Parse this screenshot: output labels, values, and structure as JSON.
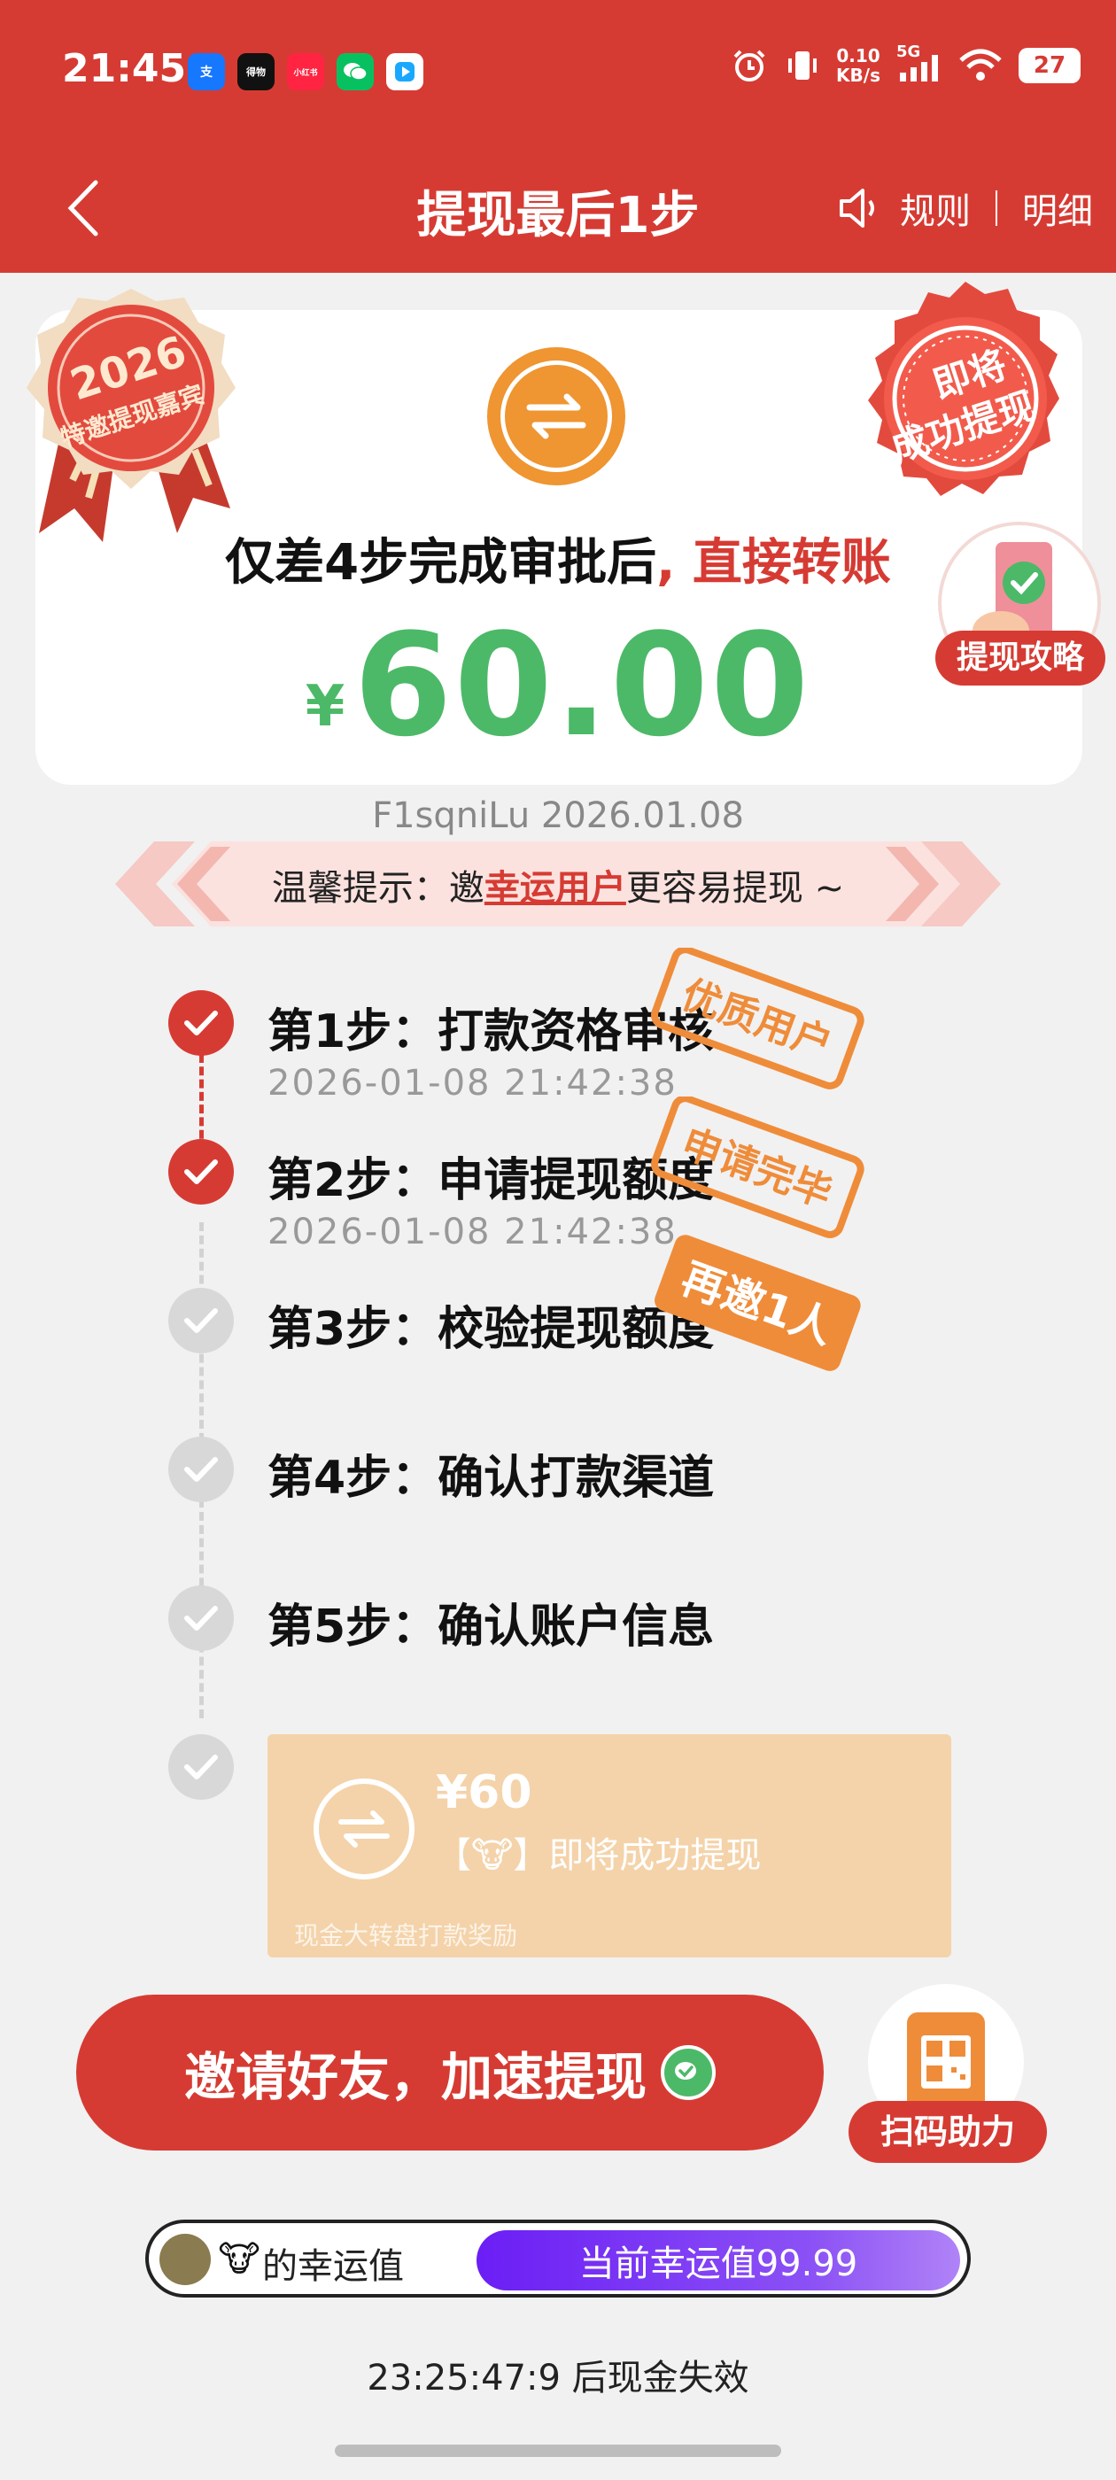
{
  "status_bar": {
    "time": "21:45",
    "apps": [
      {
        "label": "支",
        "color": "#1677ff",
        "icon": "alipay-icon"
      },
      {
        "label": "得物",
        "color": "#111111",
        "icon": "dewu-icon"
      },
      {
        "label": "小红书",
        "color": "#ff2442",
        "icon": "xiaohongshu-icon"
      },
      {
        "label": "",
        "color": "#07c160",
        "icon": "wechat-icon"
      },
      {
        "label": "",
        "color": "#ffffff",
        "icon": "video-app-icon"
      }
    ],
    "net_speed_value": "0.10",
    "net_speed_unit": "KB/s",
    "signal": "5G",
    "battery": "27"
  },
  "nav": {
    "title": "提现最后1步",
    "rules": "规则",
    "details": "明细"
  },
  "card": {
    "seal_left_line1": "2026",
    "seal_left_line2": "特邀提现嘉宾",
    "seal_right_line1": "即将",
    "seal_right_line2": "成功提现",
    "guide_label": "提现攻略",
    "line_black": "仅差4步完成审批后",
    "line_red": ", 直接转账",
    "currency": "¥",
    "amount": "60.00"
  },
  "user_line": "F1sqniLu 2026.01.08",
  "tip": {
    "prefix": "温馨提示：邀",
    "link": "幸运用户",
    "suffix": "更容易提现 ~"
  },
  "steps": [
    {
      "title": "第1步：打款资格审核",
      "time": "2026-01-08 21:42:38",
      "done": true,
      "stamp": "优质用户"
    },
    {
      "title": "第2步：申请提现额度",
      "time": "2026-01-08 21:42:38",
      "done": true,
      "stamp": "申请完毕"
    },
    {
      "title": "第3步：校验提现额度",
      "time": "",
      "done": false,
      "stamp": "再邀1人"
    },
    {
      "title": "第4步：确认打款渠道",
      "time": "",
      "done": false,
      "stamp": ""
    },
    {
      "title": "第5步：确认账户信息",
      "time": "",
      "done": false,
      "stamp": ""
    }
  ],
  "reward": {
    "amount": "¥60",
    "message": "【🐮】即将成功提现",
    "footnote": "现金大转盘打款奖励"
  },
  "cta": {
    "invite": "邀请好友，加速提现",
    "qr_label": "扫码助力"
  },
  "luck": {
    "emoji": "🐮",
    "label": "的幸运值",
    "value_text": "当前幸运值99.99"
  },
  "countdown": "23:25:47:9 后现金失效",
  "colors": {
    "primary_red": "#d63b33",
    "success_green": "#4cb968",
    "coin_orange": "#ef9531",
    "luck_purple": "#6b1ef5"
  }
}
